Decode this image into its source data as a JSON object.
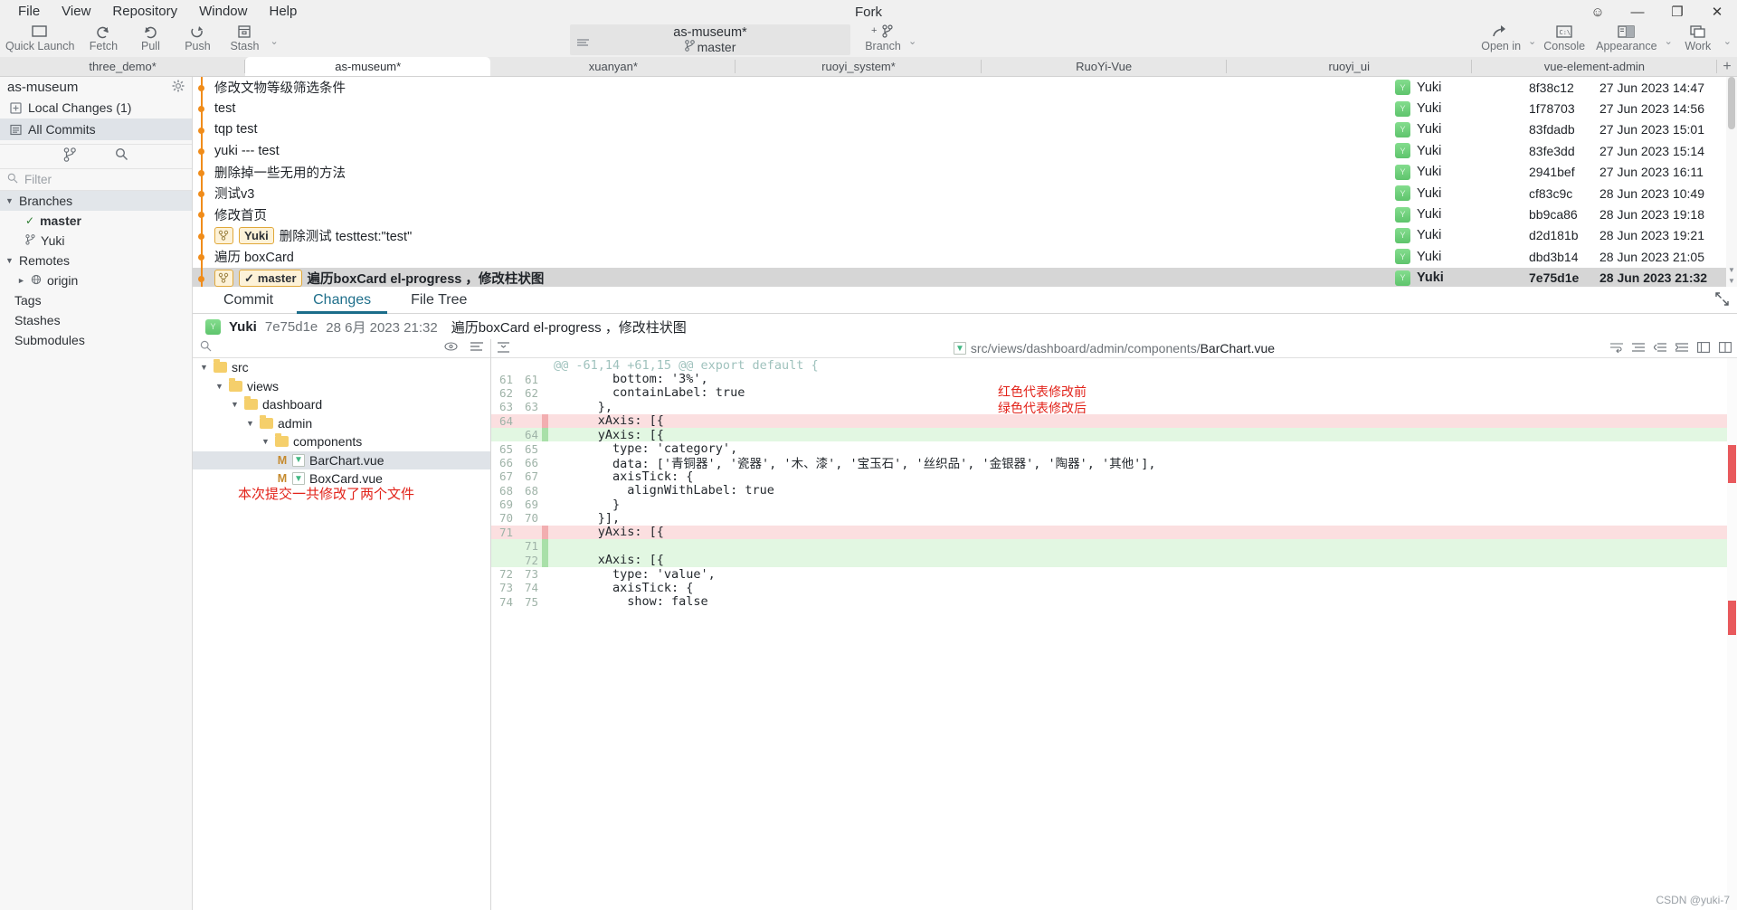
{
  "window": {
    "title": "Fork",
    "menu": [
      "File",
      "View",
      "Repository",
      "Window",
      "Help"
    ],
    "controls": {
      "emoji": "☺",
      "minimize": "—",
      "maximize": "❐",
      "close": "✕"
    }
  },
  "toolbar": {
    "left_buttons": [
      {
        "label": "Quick Launch",
        "icon": "folder-icon"
      },
      {
        "label": "Fetch",
        "icon": "fetch-arrow-icon"
      },
      {
        "label": "Pull",
        "icon": "pull-arrow-icon"
      },
      {
        "label": "Push",
        "icon": "push-arrow-icon"
      },
      {
        "label": "Stash",
        "icon": "stash-box-icon"
      }
    ],
    "repo_selector": {
      "repository": "as-museum*",
      "branch": "master",
      "branch_icon": "branch-icon",
      "list_icon": "list-icon"
    },
    "branch_button": {
      "label": "Branch",
      "icon": "add-branch-icon"
    },
    "right_buttons": [
      {
        "label": "Open in",
        "icon": "open-in-icon"
      },
      {
        "label": "Console",
        "icon": "console-icon"
      },
      {
        "label": "Appearance",
        "icon": "appearance-icon"
      },
      {
        "label": "Work",
        "icon": "workspace-icon"
      }
    ]
  },
  "tabs": {
    "items": [
      {
        "label": "three_demo*",
        "active": false
      },
      {
        "label": "as-museum*",
        "active": true
      },
      {
        "label": "xuanyan*",
        "active": false
      },
      {
        "label": "ruoyi_system*",
        "active": false
      },
      {
        "label": "RuoYi-Vue",
        "active": false
      },
      {
        "label": "ruoyi_ui",
        "active": false
      },
      {
        "label": "vue-element-admin",
        "active": false
      }
    ],
    "add_label": "+"
  },
  "sidebar": {
    "repo_name": "as-museum",
    "gear_icon": "gear-icon",
    "entries": [
      {
        "label": "Local Changes (1)",
        "icon": "changes-icon",
        "selected": false
      },
      {
        "label": "All Commits",
        "icon": "commits-icon",
        "selected": true
      }
    ],
    "actions": [
      {
        "icon": "branch-icon"
      },
      {
        "icon": "search-icon"
      }
    ],
    "filter_placeholder": "Filter",
    "filter_icon": "search-icon",
    "tree": [
      {
        "label": "Branches",
        "type": "section",
        "expanded": true,
        "highlight": true
      },
      {
        "label": "master",
        "type": "branch",
        "checked": true
      },
      {
        "label": "Yuki",
        "type": "branch",
        "checked": false
      },
      {
        "label": "Remotes",
        "type": "section",
        "expanded": true,
        "highlight": false
      },
      {
        "label": "origin",
        "type": "remote",
        "expanded": false
      },
      {
        "label": "Tags",
        "type": "section-plain"
      },
      {
        "label": "Stashes",
        "type": "section-plain"
      },
      {
        "label": "Submodules",
        "type": "section-plain"
      }
    ]
  },
  "commit_list": {
    "rows": [
      {
        "message": "遍历boxCard el-progress  ，修改柱状图",
        "badge": "master",
        "badge_check": "✓",
        "tag_icon": true,
        "bold": true,
        "author": "Yuki",
        "hash": "7e75d1e",
        "date": "28 Jun 2023 21:32",
        "selected": true
      },
      {
        "message": "遍历 boxCard",
        "author": "Yuki",
        "hash": "dbd3b14",
        "date": "28 Jun 2023 21:05"
      },
      {
        "message": "删除测试 testtest:\"test\"",
        "badge": "Yuki",
        "tag_icon": true,
        "author": "Yuki",
        "hash": "d2d181b",
        "date": "28 Jun 2023 19:21"
      },
      {
        "message": "修改首页",
        "author": "Yuki",
        "hash": "bb9ca86",
        "date": "28 Jun 2023 19:18"
      },
      {
        "message": "测试v3",
        "author": "Yuki",
        "hash": "cf83c9c",
        "date": "28 Jun 2023 10:49"
      },
      {
        "message": "删除掉一些无用的方法",
        "author": "Yuki",
        "hash": "2941bef",
        "date": "27 Jun 2023 16:11"
      },
      {
        "message": "yuki --- test",
        "author": "Yuki",
        "hash": "83fe3dd",
        "date": "27 Jun 2023 15:14"
      },
      {
        "message": "tqp test",
        "author": "Yuki",
        "hash": "83fdadb",
        "date": "27 Jun 2023 15:01"
      },
      {
        "message": "test",
        "author": "Yuki",
        "hash": "1f78703",
        "date": "27 Jun 2023 14:56"
      },
      {
        "message": "修改文物等级筛选条件",
        "author": "Yuki",
        "hash": "8f38c12",
        "date": "27 Jun 2023 14:47"
      }
    ]
  },
  "panel": {
    "tabs": [
      {
        "label": "Commit",
        "active": false
      },
      {
        "label": "Changes",
        "active": true
      },
      {
        "label": "File Tree",
        "active": false
      }
    ],
    "expand_icon": "expand-icon",
    "commit_header": {
      "avatar_letter": "Y",
      "author": "Yuki",
      "hash": "7e75d1e",
      "date": "28 6月 2023 21:32",
      "message": "遍历boxCard el-progress  ，修改柱状图"
    }
  },
  "file_tree": {
    "search_icon": "search-icon",
    "eye_icon": "eye-icon",
    "list-icon": "list-icon",
    "nodes": [
      {
        "label": "src",
        "type": "folder",
        "depth": 0,
        "expanded": true
      },
      {
        "label": "views",
        "type": "folder",
        "depth": 1,
        "expanded": true
      },
      {
        "label": "dashboard",
        "type": "folder",
        "depth": 2,
        "expanded": true
      },
      {
        "label": "admin",
        "type": "folder",
        "depth": 3,
        "expanded": true
      },
      {
        "label": "components",
        "type": "folder",
        "depth": 4,
        "expanded": true
      },
      {
        "label": "BarChart.vue",
        "type": "file",
        "depth": 5,
        "status": "M",
        "selected": true
      },
      {
        "label": "BoxCard.vue",
        "type": "file",
        "depth": 5,
        "status": "M",
        "selected": false
      }
    ],
    "annotation": "本次提交一共修改了两个文件"
  },
  "diff": {
    "file_icon": "vue-file-icon",
    "path_prefix": "src/views/dashboard/admin/components/",
    "path_file": "BarChart.vue",
    "header_icons_left": [
      "minimize-icon",
      "paragraph-icon"
    ],
    "header_icons_right": [
      "wrap-icon",
      "unindent-icon",
      "indent-icon",
      "expand-icon",
      "split-icon"
    ],
    "annotations": [
      "红色代表修改前",
      "绿色代表修改后"
    ],
    "lines": [
      {
        "old": "",
        "new": "",
        "type": "hunk",
        "text": "@@ -61,14 +61,15 @@ export default {"
      },
      {
        "old": "61",
        "new": "61",
        "type": "ctx",
        "text": "        bottom: '3%',"
      },
      {
        "old": "62",
        "new": "62",
        "type": "ctx",
        "text": "        containLabel: true"
      },
      {
        "old": "63",
        "new": "63",
        "type": "ctx",
        "text": "      },"
      },
      {
        "old": "64",
        "new": "",
        "type": "del",
        "text": "      xAxis: [{"
      },
      {
        "old": "",
        "new": "64",
        "type": "add",
        "text": "      yAxis: [{"
      },
      {
        "old": "65",
        "new": "65",
        "type": "ctx",
        "text": "        type: 'category',"
      },
      {
        "old": "66",
        "new": "66",
        "type": "ctx",
        "text": "        data: ['青铜器', '瓷器', '木、漆', '宝玉石', '丝织品', '金银器', '陶器', '其他'],"
      },
      {
        "old": "67",
        "new": "67",
        "type": "ctx",
        "text": "        axisTick: {"
      },
      {
        "old": "68",
        "new": "68",
        "type": "ctx",
        "text": "          alignWithLabel: true"
      },
      {
        "old": "69",
        "new": "69",
        "type": "ctx",
        "text": "        }"
      },
      {
        "old": "70",
        "new": "70",
        "type": "ctx",
        "text": "      }],"
      },
      {
        "old": "71",
        "new": "",
        "type": "del",
        "text": "      yAxis: [{"
      },
      {
        "old": "",
        "new": "71",
        "type": "add",
        "text": ""
      },
      {
        "old": "",
        "new": "72",
        "type": "add",
        "text": "      xAxis: [{"
      },
      {
        "old": "72",
        "new": "73",
        "type": "ctx",
        "text": "        type: 'value',"
      },
      {
        "old": "73",
        "new": "74",
        "type": "ctx",
        "text": "        axisTick: {"
      },
      {
        "old": "74",
        "new": "75",
        "type": "ctx",
        "text": "          show: false"
      }
    ]
  },
  "watermark": "CSDN @yuki-7"
}
